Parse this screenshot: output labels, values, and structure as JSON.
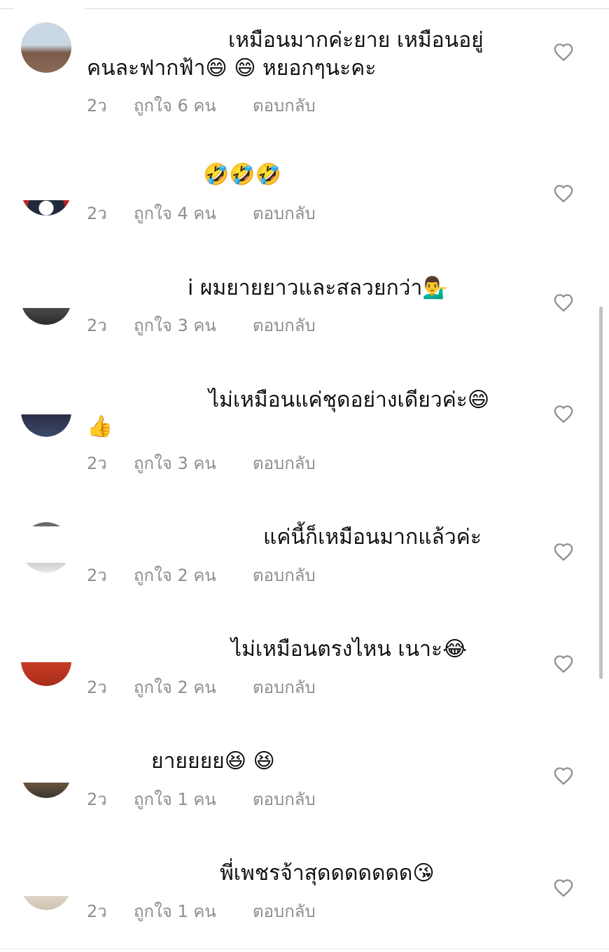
{
  "comments": [
    {
      "lines": [
        "เหมือนมากค่ะยาย เหมือนอยู่",
        "คนละฟากฟ้า😄 😄  หยอกๆนะคะ"
      ],
      "time": "2ว",
      "likes": "ถูกใจ 6 คน",
      "reply": "ตอบกลับ",
      "avatar_colors": [
        "#c9d6e3",
        "#7a5a4a"
      ]
    },
    {
      "lines": [
        "🤣🤣🤣"
      ],
      "time": "2ว",
      "likes": "ถูกใจ 4 คน",
      "reply": "ตอบกลับ",
      "avatar_colors": [
        "#202a3a",
        "#b8252a"
      ]
    },
    {
      "lines": [
        "i ผมยายยาวและสลวยกว่า💁‍♂️"
      ],
      "time": "2ว",
      "likes": "ถูกใจ 3 คน",
      "reply": "ตอบกลับ",
      "avatar_colors": [
        "#5a5a5a",
        "#2b2b2b"
      ]
    },
    {
      "lines": [
        "ไม่เหมือนแค่ชุดอย่างเดียวค่ะ😄",
        "👍"
      ],
      "time": "2ว",
      "likes": "ถูกใจ 3 คน",
      "reply": "ตอบกลับ",
      "avatar_colors": [
        "#2a2d45",
        "#3b4a6b"
      ]
    },
    {
      "lines": [
        "แค่นี้ก็เหมือนมากแล้วค่ะ"
      ],
      "time": "2ว",
      "likes": "ถูกใจ 2 คน",
      "reply": "ตอบกลับ",
      "avatar_colors": [
        "#6a6a6a",
        "#cfcfcf"
      ]
    },
    {
      "lines": [
        "ไม่เหมือนตรงไหน เนาะ😂"
      ],
      "time": "2ว",
      "likes": "ถูกใจ 2 คน",
      "reply": "ตอบกลับ",
      "avatar_colors": [
        "#c23a22",
        "#e0603a"
      ]
    },
    {
      "lines": [
        "ยายยยย😆 😆"
      ],
      "time": "2ว",
      "likes": "ถูกใจ 1 คน",
      "reply": "ตอบกลับ",
      "avatar_colors": [
        "#3a3530",
        "#d9a468"
      ]
    },
    {
      "lines": [
        "พี่เพชรจ้าสุดดดดดดด😘"
      ],
      "time": "2ว",
      "likes": "ถูกใจ 1 คน",
      "reply": "ตอบกลับ",
      "avatar_colors": [
        "#e8e2da",
        "#cfc2b0"
      ]
    }
  ],
  "icons": {
    "like": "heart-outline-icon"
  },
  "colors": {
    "text": "#111111",
    "meta": "#8e8e8e",
    "heart": "#8e8e8e",
    "background": "#ffffff"
  }
}
